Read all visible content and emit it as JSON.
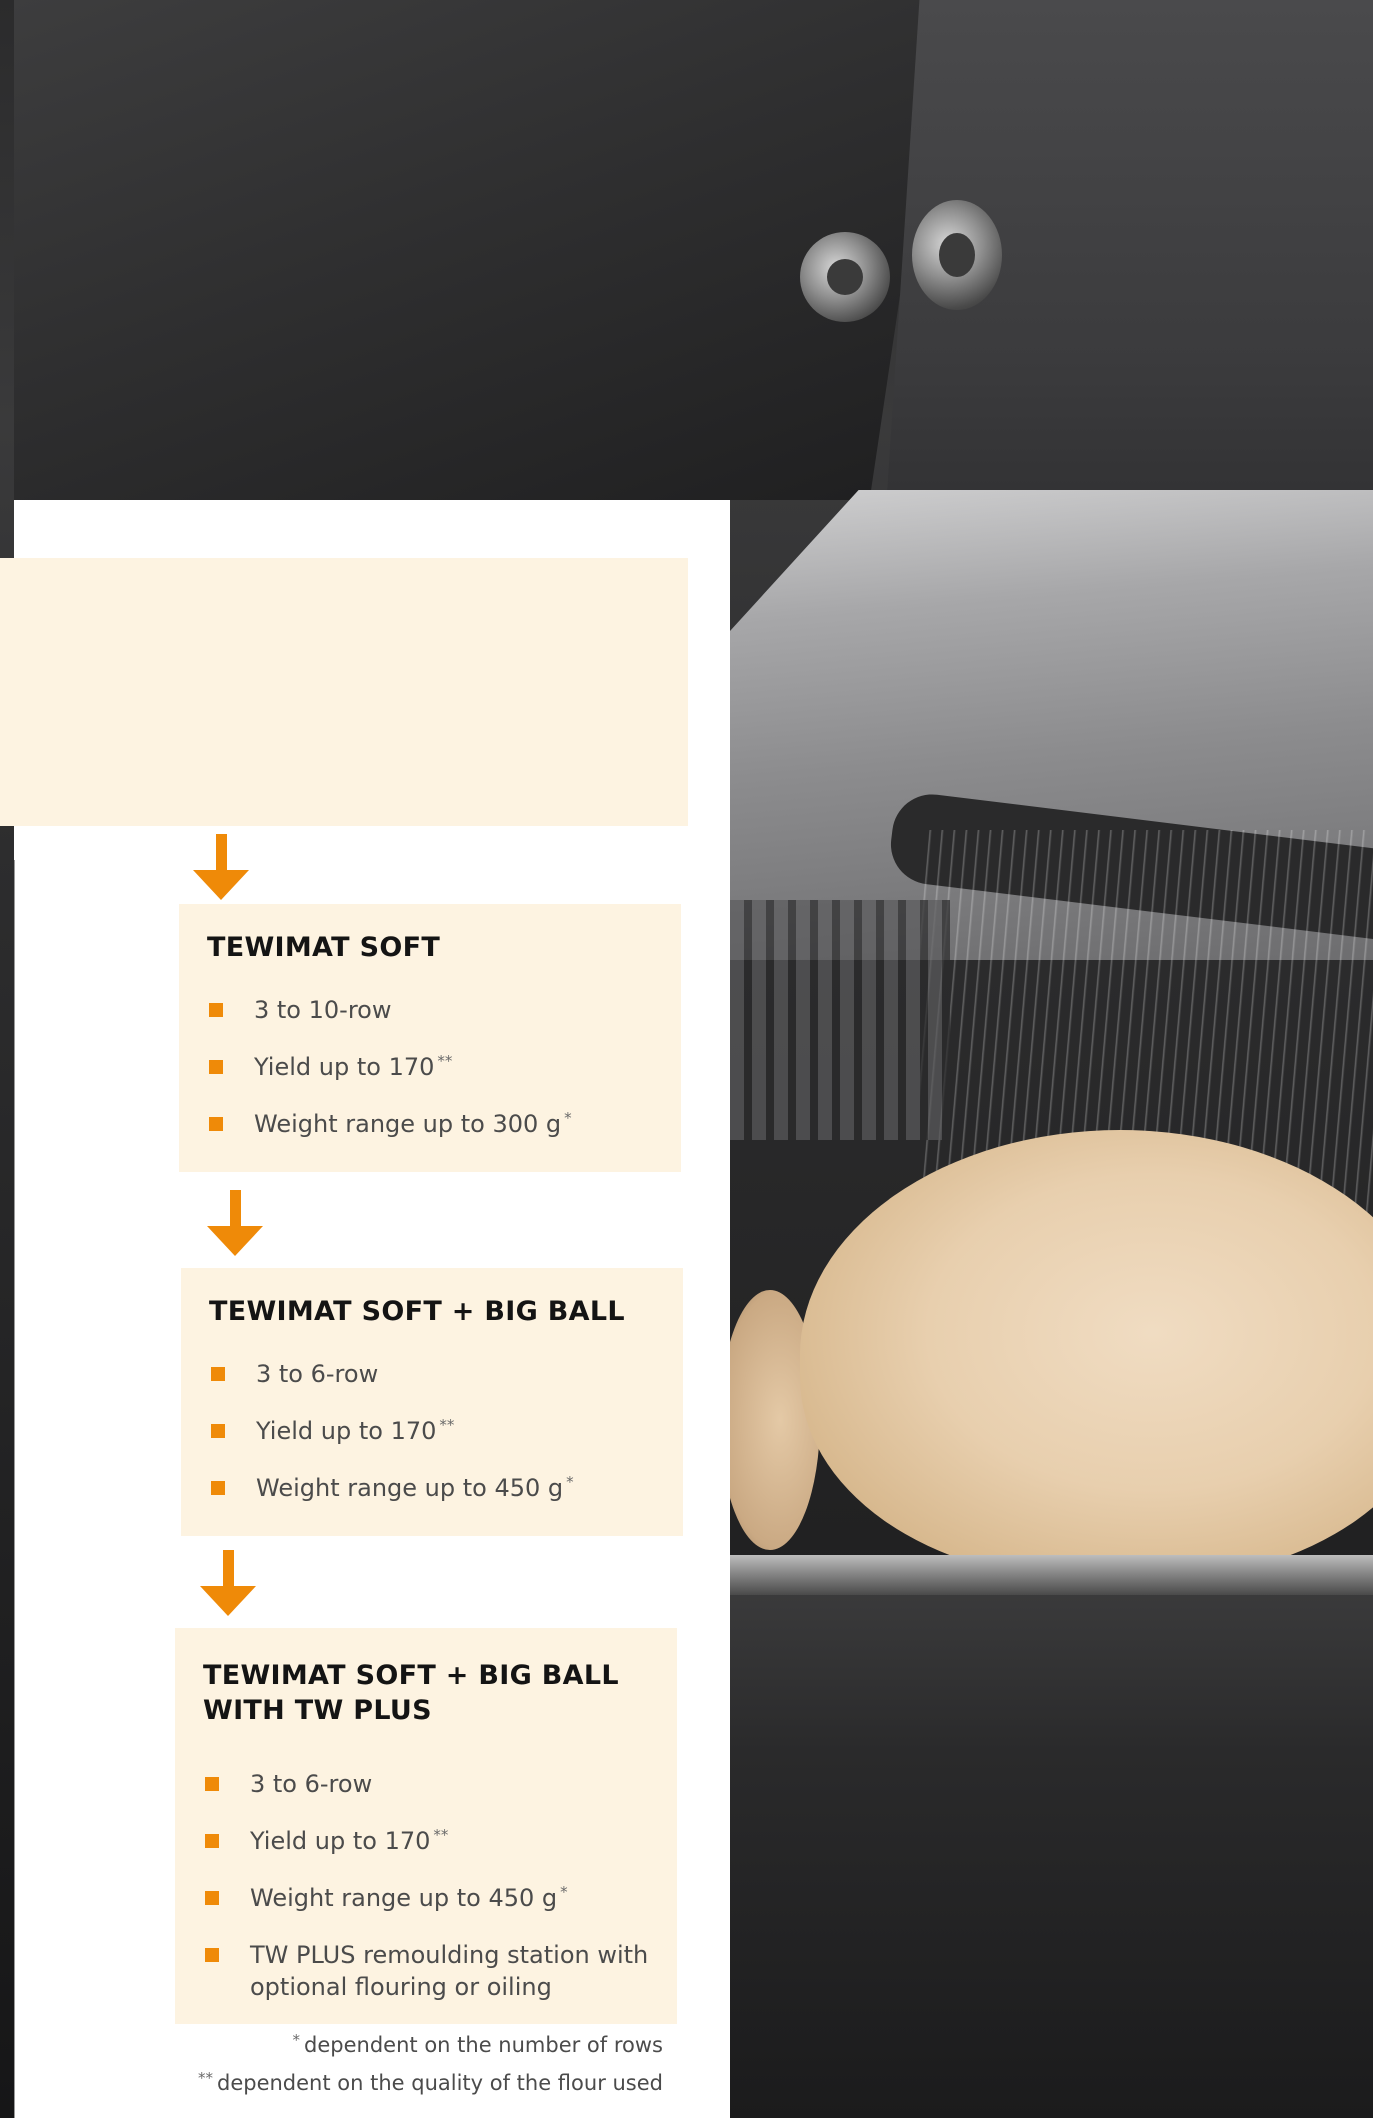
{
  "colors": {
    "accent": "#ef8a08",
    "card_background": "#fdf3e1",
    "panel_background": "#ffffff",
    "title_text": "#141414",
    "body_text": "#4b4b4b"
  },
  "background_photo": {
    "icon": "dough-rounding-machine-photo"
  },
  "flow": {
    "arrow_icon": "arrow-down-icon",
    "cards": [
      {
        "title_lines": [
          "TEWIMAT SOFT"
        ],
        "bullets": [
          {
            "text": "3 to 10-row",
            "mark": ""
          },
          {
            "text": "Yield up to 170",
            "mark": "**"
          },
          {
            "text": "Weight range up to 300 g",
            "mark": "*"
          }
        ]
      },
      {
        "title_lines": [
          "TEWIMAT SOFT + BIG BALL"
        ],
        "bullets": [
          {
            "text": "3 to 6-row",
            "mark": ""
          },
          {
            "text": "Yield up to 170",
            "mark": "**"
          },
          {
            "text": "Weight range up to 450 g",
            "mark": "*"
          }
        ]
      },
      {
        "title_lines": [
          "TEWIMAT SOFT + BIG BALL",
          "WITH TW PLUS"
        ],
        "bullets": [
          {
            "text": "3 to 6-row",
            "mark": ""
          },
          {
            "text": "Yield up to 170",
            "mark": "**"
          },
          {
            "text": "Weight range up to 450 g",
            "mark": "*"
          },
          {
            "text_lines": [
              "TW PLUS remoulding station with",
              "optional flouring or oiling"
            ],
            "mark": ""
          }
        ]
      }
    ]
  },
  "footnotes": [
    {
      "mark": "*",
      "text": "dependent on the number of rows"
    },
    {
      "mark": "**",
      "text": "dependent on the quality of the flour used"
    }
  ]
}
